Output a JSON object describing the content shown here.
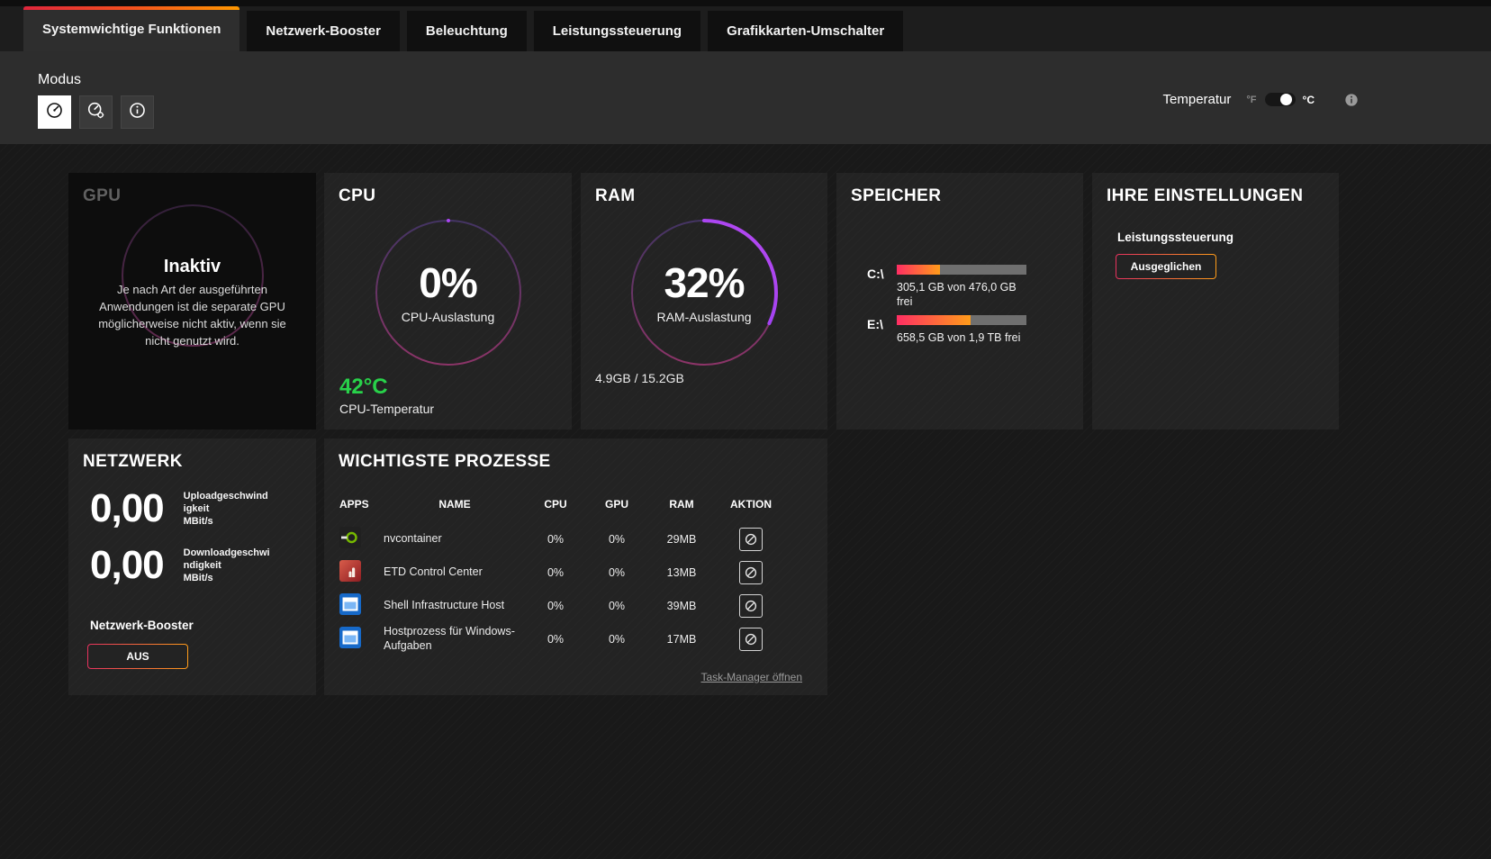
{
  "colors": {
    "accent_gradient_start": "#e8325f",
    "accent_gradient_end": "#ff9c1a",
    "temp_green": "#28d24a",
    "ring_purple": "#8b3ff0",
    "nvidia_green": "#76b900"
  },
  "tabs": [
    {
      "label": "Systemwichtige Funktionen",
      "active": true
    },
    {
      "label": "Netzwerk-Booster",
      "active": false
    },
    {
      "label": "Beleuchtung",
      "active": false
    },
    {
      "label": "Leistungssteuerung",
      "active": false
    },
    {
      "label": "Grafikkarten-Umschalter",
      "active": false
    }
  ],
  "subheader": {
    "modus_label": "Modus",
    "temperature_label": "Temperatur",
    "unit_fahrenheit": "°F",
    "unit_celsius": "°C"
  },
  "gpu_card": {
    "title": "GPU",
    "status": "Inaktiv",
    "description": "Je nach Art der ausgeführten Anwendungen ist die separate GPU möglicherweise nicht aktiv, wenn sie nicht genutzt wird."
  },
  "cpu_card": {
    "title": "CPU",
    "usage": "0%",
    "usage_pct": 0,
    "usage_label": "CPU-Auslastung",
    "temperature": "42°C",
    "temperature_label": "CPU-Temperatur"
  },
  "ram_card": {
    "title": "RAM",
    "usage": "32%",
    "usage_pct": 32,
    "usage_label": "RAM-Auslastung",
    "detail": "4.9GB / 15.2GB"
  },
  "storage_card": {
    "title": "SPEICHER",
    "drives": [
      {
        "label": "C:\\",
        "info": "305,1 GB von 476,0 GB frei",
        "used_pct": 33
      },
      {
        "label": "E:\\",
        "info": "658,5 GB von 1,9 TB frei",
        "used_pct": 57
      }
    ]
  },
  "settings_card": {
    "title": "IHRE EINSTELLUNGEN",
    "section_label": "Leistungssteuerung",
    "mode_button": "Ausgeglichen"
  },
  "network_card": {
    "title": "NETZWERK",
    "upload_value": "0,00",
    "upload_label": "Uploadgeschwindigkeit",
    "upload_unit": "MBit/s",
    "download_value": "0,00",
    "download_label": "Downloadgeschwindigkeit",
    "download_unit": "MBit/s",
    "booster_label": "Netzwerk-Booster",
    "booster_state": "AUS"
  },
  "processes_card": {
    "title": "WICHTIGSTE PROZESSE",
    "headers": {
      "apps": "APPS",
      "name": "NAME",
      "cpu": "CPU",
      "gpu": "GPU",
      "ram": "RAM",
      "action": "AKTION"
    },
    "rows": [
      {
        "icon": "nvidia-icon",
        "name": "nvcontainer",
        "cpu": "0%",
        "gpu": "0%",
        "ram": "29MB"
      },
      {
        "icon": "etd-icon",
        "name": "ETD Control Center",
        "cpu": "0%",
        "gpu": "0%",
        "ram": "13MB"
      },
      {
        "icon": "windows-icon",
        "name": "Shell Infrastructure Host",
        "cpu": "0%",
        "gpu": "0%",
        "ram": "39MB"
      },
      {
        "icon": "windows-icon",
        "name": "Hostprozess für Windows-Aufgaben",
        "cpu": "0%",
        "gpu": "0%",
        "ram": "17MB"
      }
    ],
    "task_manager_link": "Task-Manager öffnen"
  }
}
